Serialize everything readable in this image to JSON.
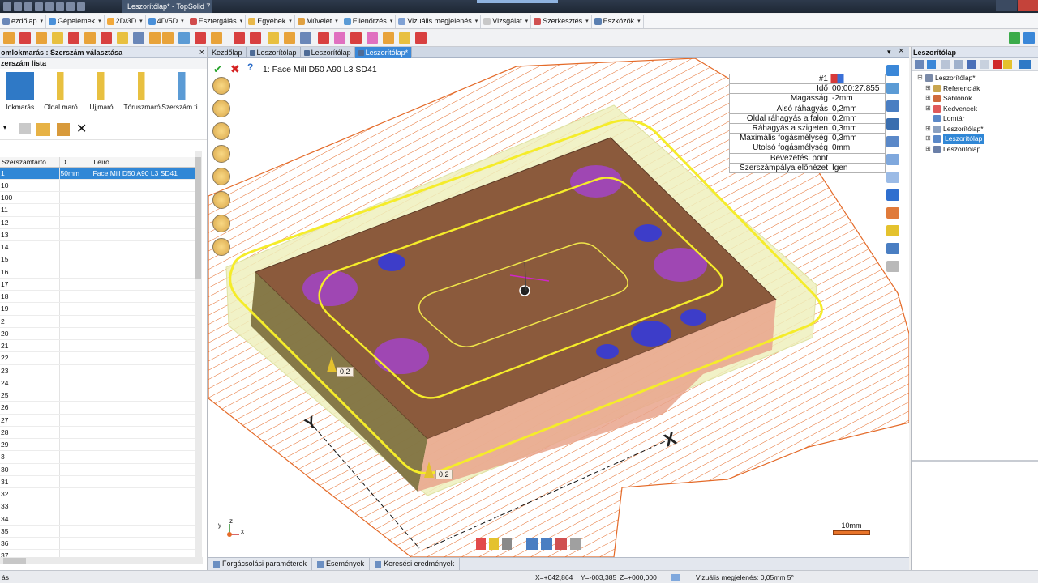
{
  "window": {
    "title": "Leszorítólap* - TopSolid 7"
  },
  "menubar": {
    "items": [
      {
        "label": "ezdőlap",
        "color": "#6a87b8"
      },
      {
        "label": "Gépelemek",
        "color": "#4a90d9"
      },
      {
        "label": "2D/3D",
        "color": "#f2a93b"
      },
      {
        "label": "4D/5D",
        "color": "#4a90d9"
      },
      {
        "label": "Esztergálás",
        "color": "#d04b4b"
      },
      {
        "label": "Egyebek",
        "color": "#e8b84a"
      },
      {
        "label": "Művelet",
        "color": "#e0a040"
      },
      {
        "label": "Ellenőrzés",
        "color": "#5b9bd5"
      },
      {
        "label": "Vizuális megjelenés",
        "color": "#7fa1d4"
      },
      {
        "label": "Vizsgálat",
        "color": "#c8c8c8"
      },
      {
        "label": "Szerkesztés",
        "color": "#d05050"
      },
      {
        "label": "Eszközök",
        "color": "#5a7fb0"
      }
    ]
  },
  "left_panel": {
    "title": "omlokmarás : Szerszám választása",
    "close_label": "×",
    "subtitle": "zerszám lista",
    "tool_types": [
      {
        "label": "lokmarás",
        "selected": true
      },
      {
        "label": "Oldal maró",
        "selected": false
      },
      {
        "label": "Ujjmaró",
        "selected": false
      },
      {
        "label": "Tóruszmaró",
        "selected": false
      },
      {
        "label": "Szerszám ti...",
        "selected": false
      }
    ],
    "table": {
      "headers": [
        "Szerszámtartó",
        "D",
        "Leíró"
      ],
      "rows": [
        {
          "id": "1",
          "d": "50mm",
          "desc": "Face Mill D50 A90 L3 SD41",
          "selected": true
        },
        {
          "id": "10",
          "d": "",
          "desc": ""
        },
        {
          "id": "100",
          "d": "",
          "desc": ""
        },
        {
          "id": "11",
          "d": "",
          "desc": ""
        },
        {
          "id": "12",
          "d": "",
          "desc": ""
        },
        {
          "id": "13",
          "d": "",
          "desc": ""
        },
        {
          "id": "14",
          "d": "",
          "desc": ""
        },
        {
          "id": "15",
          "d": "",
          "desc": ""
        },
        {
          "id": "16",
          "d": "",
          "desc": ""
        },
        {
          "id": "17",
          "d": "",
          "desc": ""
        },
        {
          "id": "18",
          "d": "",
          "desc": ""
        },
        {
          "id": "19",
          "d": "",
          "desc": ""
        },
        {
          "id": "2",
          "d": "",
          "desc": ""
        },
        {
          "id": "20",
          "d": "",
          "desc": ""
        },
        {
          "id": "21",
          "d": "",
          "desc": ""
        },
        {
          "id": "22",
          "d": "",
          "desc": ""
        },
        {
          "id": "23",
          "d": "",
          "desc": ""
        },
        {
          "id": "24",
          "d": "",
          "desc": ""
        },
        {
          "id": "25",
          "d": "",
          "desc": ""
        },
        {
          "id": "26",
          "d": "",
          "desc": ""
        },
        {
          "id": "27",
          "d": "",
          "desc": ""
        },
        {
          "id": "28",
          "d": "",
          "desc": ""
        },
        {
          "id": "29",
          "d": "",
          "desc": ""
        },
        {
          "id": "3",
          "d": "",
          "desc": ""
        },
        {
          "id": "30",
          "d": "",
          "desc": ""
        },
        {
          "id": "31",
          "d": "",
          "desc": ""
        },
        {
          "id": "32",
          "d": "",
          "desc": ""
        },
        {
          "id": "33",
          "d": "",
          "desc": ""
        },
        {
          "id": "34",
          "d": "",
          "desc": ""
        },
        {
          "id": "35",
          "d": "",
          "desc": ""
        },
        {
          "id": "36",
          "d": "",
          "desc": ""
        },
        {
          "id": "37",
          "d": "",
          "desc": ""
        }
      ]
    }
  },
  "view_tabs": [
    {
      "label": "Kezdőlap",
      "active": false
    },
    {
      "label": "Leszorítólap",
      "active": false
    },
    {
      "label": "Leszorítólap",
      "active": false
    },
    {
      "label": "Leszorítólap*",
      "active": true
    }
  ],
  "viewport": {
    "operation_title": "1: Face Mill D50 A90 L3 SD41",
    "properties": [
      {
        "key": "#1",
        "value": ""
      },
      {
        "key": "Idő",
        "value": "00:00:27.855"
      },
      {
        "key": "Magasság",
        "value": "-2mm"
      },
      {
        "key": "Alsó ráhagyás",
        "value": "0,2mm"
      },
      {
        "key": "Oldal ráhagyás a falon",
        "value": "0,2mm"
      },
      {
        "key": "Ráhagyás a szigeten",
        "value": "0,3mm"
      },
      {
        "key": "Maximális fogásmélység",
        "value": "0,3mm"
      },
      {
        "key": "Utolsó fogásmélység",
        "value": "0mm"
      },
      {
        "key": "Bevezetési pont",
        "value": ""
      },
      {
        "key": "Szerszámpálya előnézet",
        "value": "Igen"
      }
    ],
    "dim_labels": [
      "0,2",
      "0,2"
    ],
    "axis_labels": {
      "x": "X",
      "y": "Y",
      "tri_x": "x",
      "tri_y": "y",
      "tri_z": "z"
    },
    "scale_label": "10mm"
  },
  "bottom_tabs": [
    "Forgácsolási paraméterek",
    "Események",
    "Keresési eredmények"
  ],
  "statusbar": {
    "left": "ás",
    "x": "X=+042,864",
    "y": "Y=-003,385",
    "z": "Z=+000,000",
    "visual": "Vizuális megjelenés: 0,05mm 5°"
  },
  "right_panel": {
    "title": "Leszorítólap",
    "tree": [
      {
        "label": "Leszorítólap*",
        "indent": 0,
        "expander": "⊟",
        "color": "#7a8aa8"
      },
      {
        "label": "Referenciák",
        "indent": 1,
        "expander": "⊞",
        "color": "#c9a650"
      },
      {
        "label": "Sablonok",
        "indent": 1,
        "expander": "⊞",
        "color": "#d06a3c"
      },
      {
        "label": "Kedvencek",
        "indent": 1,
        "expander": "⊞",
        "color": "#e05a5a"
      },
      {
        "label": "Lomtár",
        "indent": 1,
        "expander": "",
        "color": "#5a88c8"
      },
      {
        "label": "Leszorítólap*",
        "indent": 1,
        "expander": "⊞",
        "color": "#8aa0c0"
      },
      {
        "label": "Leszorítólap",
        "indent": 1,
        "expander": "⊞",
        "color": "#5a88c8",
        "selected": true
      },
      {
        "label": "Leszorítólap",
        "indent": 1,
        "expander": "⊞",
        "color": "#6a7fa8"
      }
    ]
  }
}
